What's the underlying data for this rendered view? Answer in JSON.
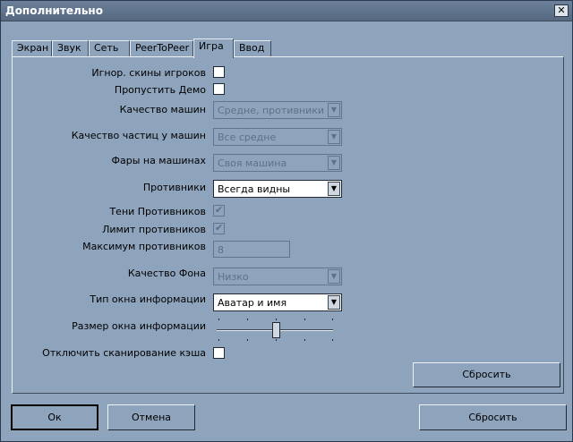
{
  "window": {
    "title": "Дополнительно",
    "close": "✕"
  },
  "tabs": [
    "Экран",
    "Звук",
    "Сеть",
    "PeerToPeer",
    "Игра",
    "Ввод"
  ],
  "game": {
    "ignore_skins": {
      "label": "Игнор. скины игроков",
      "checked": false
    },
    "skip_demo": {
      "label": "Пропустить Демо",
      "checked": false
    },
    "car_quality": {
      "label": "Качество машин",
      "value": "Средне, противники низ",
      "enabled": false
    },
    "particle_quality": {
      "label": "Качество частиц у машин",
      "value": "Все средне",
      "enabled": false
    },
    "headlights": {
      "label": "Фары на машинах",
      "value": "Своя машина",
      "enabled": false
    },
    "opponents": {
      "label": "Противники",
      "value": "Всегда видны",
      "enabled": true
    },
    "opponent_shadows": {
      "label": "Тени Противников",
      "checked": true,
      "enabled": false
    },
    "opponent_limit": {
      "label": "Лимит противников",
      "checked": true,
      "enabled": false
    },
    "max_opponents": {
      "label": "Максимум противников",
      "value": "8",
      "enabled": false
    },
    "background_quality": {
      "label": "Качество Фона",
      "value": "Низко",
      "enabled": false
    },
    "info_window_type": {
      "label": "Тип окна информации",
      "value": "Аватар и имя",
      "enabled": true
    },
    "info_window_size": {
      "label": "Размер окна информации",
      "level": 0.5
    },
    "disable_cache_scan": {
      "label": "Отключить сканирование кэша",
      "checked": false
    },
    "reset_panel": "Сбросить"
  },
  "footer": {
    "ok": "Ок",
    "cancel": "Отмена",
    "reset": "Сбросить"
  },
  "icons": {
    "dropdown": "▼",
    "check": "✔"
  }
}
